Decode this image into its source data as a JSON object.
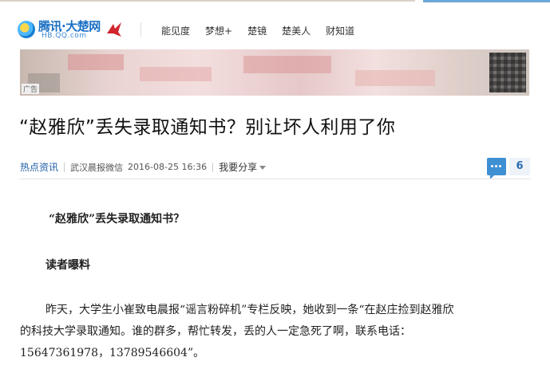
{
  "header": {
    "logo_text": "腾讯·大楚网",
    "logo_url": "HB.QQ.com",
    "nav": [
      "能见度",
      "梦想+",
      "楚镜",
      "楚美人",
      "财知道"
    ]
  },
  "banner": {
    "ad_label": "广告"
  },
  "article": {
    "title": "“赵雅欣”丢失录取通知书？别让坏人利用了你",
    "category": "热点资讯",
    "source": "武汉晨报微信",
    "datetime": "2016-08-25 16:36",
    "share_label": "我要分享",
    "comment_count": "6",
    "subtitle": "“赵雅欣”丢失录取通知书？",
    "section_heading": "读者曝料",
    "paragraph_line1": "昨天，大学生小崔致电晨报“谣言粉碎机”专栏反映，她收到一条“在赵庄捡到赵雅欣",
    "paragraph_line2": "的科技大学录取通知。谁的群多，帮忙转发，丢的人一定急死了啊，联系电话：",
    "paragraph_line3": "15647361978，13789546604”。"
  },
  "colors": {
    "link_blue": "#1f5fa8",
    "comment_blue": "#3f8fd3"
  }
}
